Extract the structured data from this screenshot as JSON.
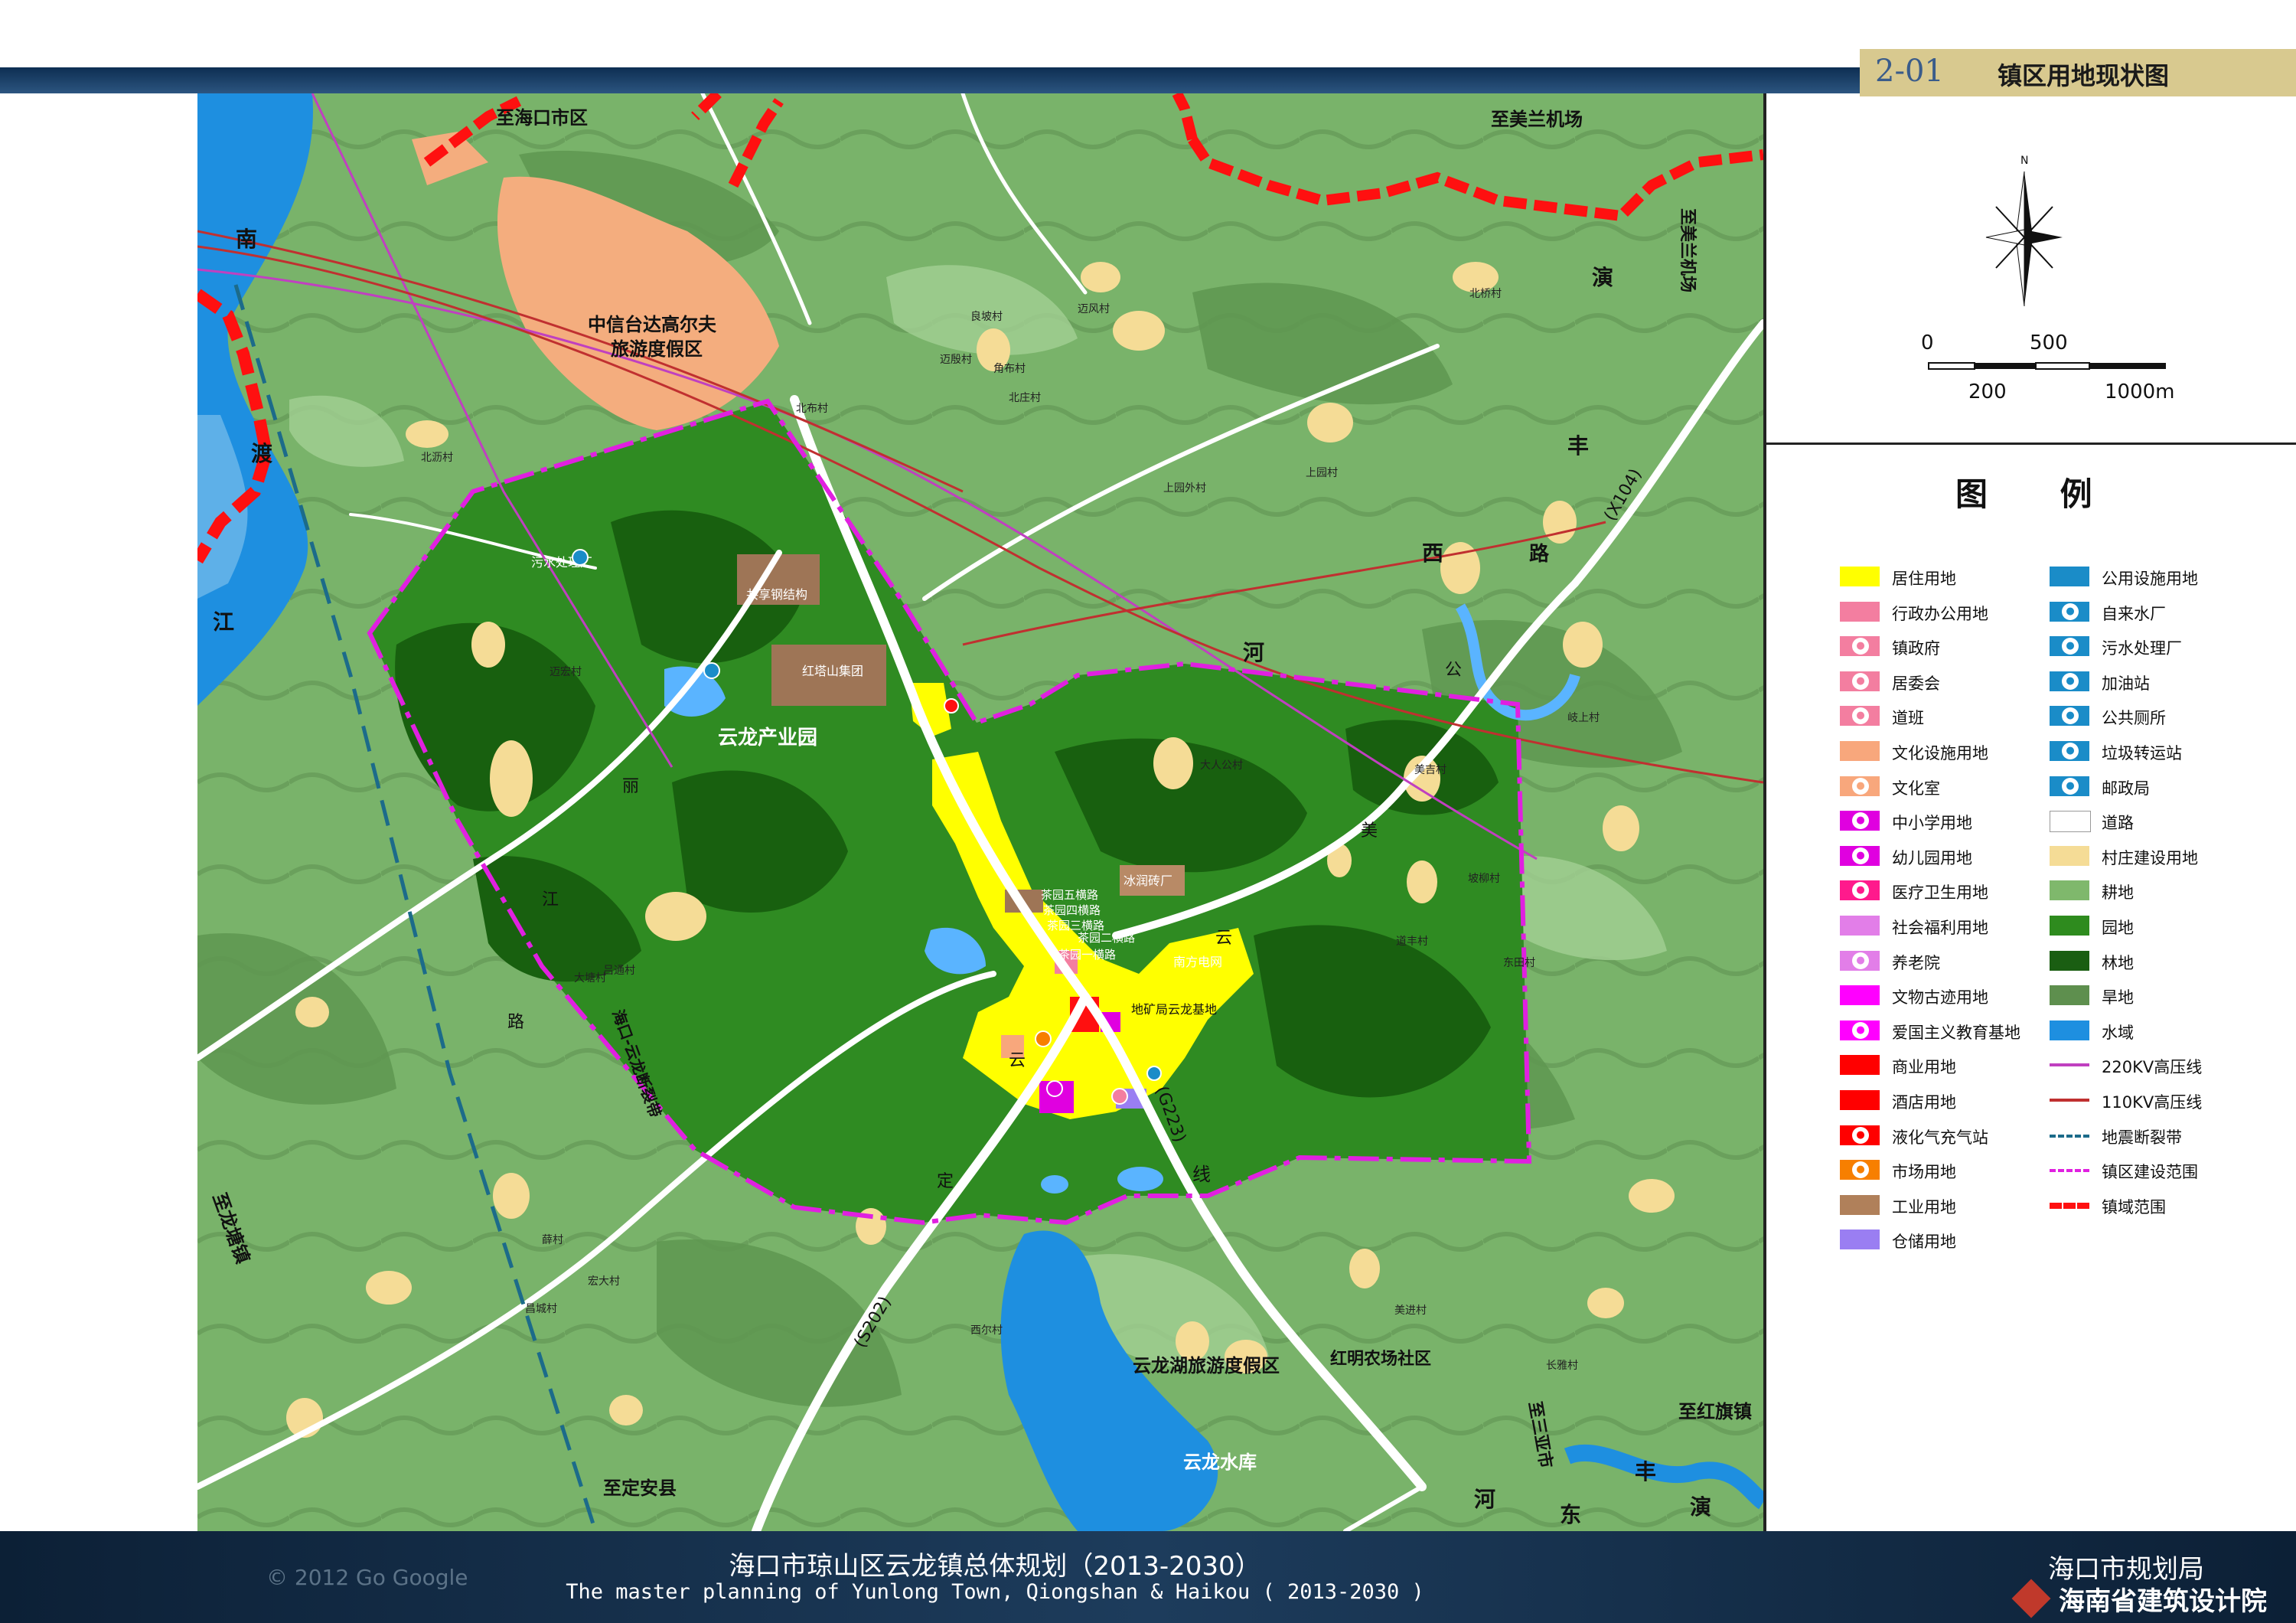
{
  "header": {
    "code": "2-01",
    "title": "镇区用地现状图"
  },
  "north_label": "N",
  "scale": {
    "labels_top": [
      "0",
      "500"
    ],
    "labels_bottom": [
      "200",
      "1000m"
    ]
  },
  "legend": {
    "title": "图 例",
    "left_column": [
      {
        "label": "居住用地",
        "color": "#ffff00",
        "icon": "fill"
      },
      {
        "label": "行政办公用地",
        "color": "#f37ea0",
        "icon": "fill"
      },
      {
        "label": "镇政府",
        "color": "#f37ea0",
        "icon": "star-icon"
      },
      {
        "label": "居委会",
        "color": "#f37ea0",
        "icon": "triangle-icon"
      },
      {
        "label": "道班",
        "color": "#f37ea0",
        "icon": "circle-glyph-icon"
      },
      {
        "label": "文化设施用地",
        "color": "#f8a77c",
        "icon": "fill"
      },
      {
        "label": "文化室",
        "color": "#f8a77c",
        "icon": "circle-glyph-icon"
      },
      {
        "label": "中小学用地",
        "color": "#e000e0",
        "icon": "school-icon"
      },
      {
        "label": "幼儿园用地",
        "color": "#e000e0",
        "icon": "circle-glyph-icon"
      },
      {
        "label": "医疗卫生用地",
        "color": "#ff1a8c",
        "icon": "medical-icon"
      },
      {
        "label": "社会福利用地",
        "color": "#e27ee8",
        "icon": "fill"
      },
      {
        "label": "养老院",
        "color": "#e27ee8",
        "icon": "circle-glyph-icon"
      },
      {
        "label": "文物古迹用地",
        "color": "#ff00ff",
        "icon": "fill"
      },
      {
        "label": "爱国主义教育基地",
        "color": "#ff00ff",
        "icon": "circle-glyph-icon"
      },
      {
        "label": "商业用地",
        "color": "#ff0000",
        "icon": "fill"
      },
      {
        "label": "酒店用地",
        "color": "#ff0000",
        "icon": "fill"
      },
      {
        "label": "液化气充气站",
        "color": "#ff0000",
        "icon": "gas-icon"
      },
      {
        "label": "市场用地",
        "color": "#f77f00",
        "icon": "market-icon"
      },
      {
        "label": "工业用地",
        "color": "#b0805a",
        "icon": "fill"
      },
      {
        "label": "仓储用地",
        "color": "#9a7ef2",
        "icon": "fill"
      }
    ],
    "right_column": [
      {
        "label": "公用设施用地",
        "color": "#1a8cc8",
        "icon": "fill"
      },
      {
        "label": "自来水厂",
        "color": "#1a8cc8",
        "icon": "water-plant-icon"
      },
      {
        "label": "污水处理厂",
        "color": "#1a8cc8",
        "icon": "sewage-icon"
      },
      {
        "label": "加油站",
        "color": "#1a8cc8",
        "icon": "fuel-icon"
      },
      {
        "label": "公共厕所",
        "color": "#1a8cc8",
        "icon": "toilet-icon"
      },
      {
        "label": "垃圾转运站",
        "color": "#1a8cc8",
        "icon": "recycle-icon"
      },
      {
        "label": "邮政局",
        "color": "#1a8cc8",
        "icon": "post-icon"
      },
      {
        "label": "道路",
        "color": "#ffffff",
        "icon": "road"
      },
      {
        "label": "村庄建设用地",
        "color": "#f5dc96",
        "icon": "fill"
      },
      {
        "label": "耕地",
        "color": "#7fb86c",
        "icon": "fill"
      },
      {
        "label": "园地",
        "color": "#2e8b1e",
        "icon": "fill"
      },
      {
        "label": "林地",
        "color": "#1a5e12",
        "icon": "fill"
      },
      {
        "label": "旱地",
        "color": "#5e8f4e",
        "icon": "fill"
      },
      {
        "label": "水域",
        "color": "#1e8fe0",
        "icon": "fill"
      },
      {
        "label": "220KV高压线",
        "color": "#c040c0",
        "icon": "line"
      },
      {
        "label": "110KV高压线",
        "color": "#c03030",
        "icon": "line"
      },
      {
        "label": "地震断裂带",
        "color": "#1c6b8a",
        "icon": "dash"
      },
      {
        "label": "镇区建设范围",
        "color": "#e020e0",
        "icon": "dashdot"
      },
      {
        "label": "镇域范围",
        "color": "#ff1010",
        "icon": "thick-dash"
      }
    ]
  },
  "map_labels": {
    "to_haikou": "至海口市区",
    "to_meilan": "至美兰机场",
    "to_meilan_vertical": "至美兰机场",
    "citic": "中信台达高尔夫",
    "citic2": "旅游度假区",
    "industrial_park": "云龙产业园",
    "gongxiang": "共享钢结构",
    "hongta": "红塔山集团",
    "binglan": "冰润砖厂",
    "nanfang": "南方电网",
    "dikuang": "地矿局云龙基地",
    "yunlong_lake": "云龙湖旅游度假区",
    "yunlong_reservoir": "云龙水库",
    "hongming": "红明农场社区",
    "to_longtang": "至龙塘镇",
    "to_dingan": "至定安县",
    "to_hongqi": "至红旗镇",
    "to_sanya": "至三亚市",
    "x104": "(X104)",
    "s202": "(S202)",
    "g223": "(G223)",
    "river_nandu": [
      "南",
      "渡",
      "江"
    ],
    "road_haiyan": [
      "演",
      "丰",
      "西",
      "路"
    ],
    "road_dongyan": [
      "河",
      "东",
      "丰",
      "演"
    ],
    "gongmei": [
      "公",
      "美",
      "云"
    ],
    "lijiang": [
      "丽",
      "江",
      "路"
    ],
    "dingyun": [
      "定",
      "云"
    ],
    "he": "河",
    "xian": "线",
    "fault": "海口-云龙断裂带",
    "sewage_plant": "污水处理厂",
    "tea_roads": [
      "茶园五横路",
      "茶园四横路",
      "茶园三横路",
      "茶园二横路",
      "茶园一横路"
    ],
    "villages": [
      "北布村",
      "迈殷村",
      "良坡村",
      "迈风村",
      "角布村",
      "北庄村",
      "北沥村",
      "迈宏村",
      "吕通村",
      "大塘村",
      "薛村",
      "宏大村",
      "昌城村",
      "上园村",
      "上园外村",
      "北桥村",
      "大人公村",
      "美吉村",
      "道丰村",
      "坡柳村",
      "岐上村",
      "东田村",
      "美进村",
      "长雅村",
      "西尔村"
    ]
  },
  "footer": {
    "title_cn": "海口市琼山区云龙镇总体规划（2013-2030）",
    "title_en": "The master planning of Yunlong Town, Qiongshan  & Haikou ( 2013-2030 )",
    "org1": "海口市规划局",
    "org2": "海南省建筑设计院",
    "watermark": "© 2012 Go  Google"
  }
}
